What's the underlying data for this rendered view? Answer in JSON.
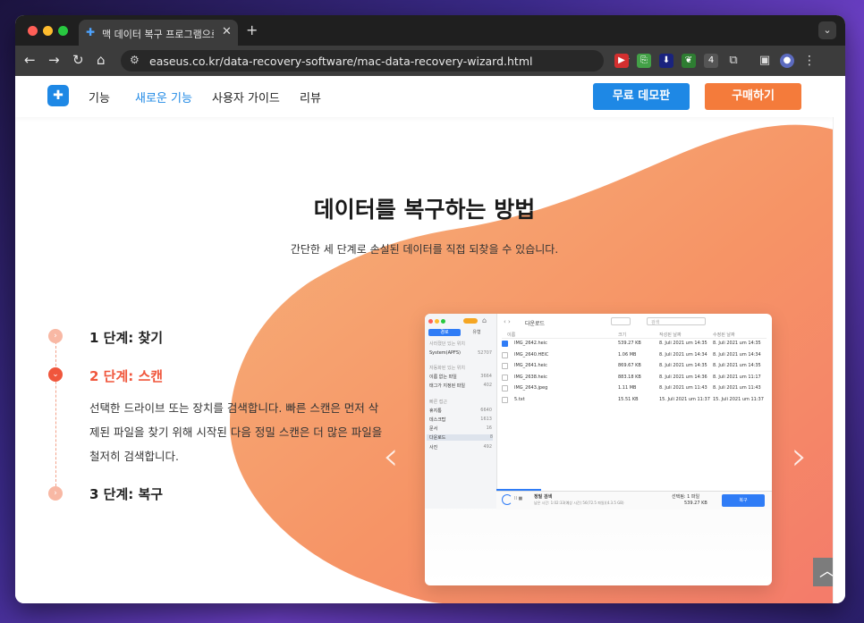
{
  "browser": {
    "tab_title": "맥 데이터 복구 프로그램으로 손실된",
    "url": "easeus.co.kr/data-recovery-software/mac-data-recovery-wizard.html",
    "ext_badge": "4"
  },
  "header": {
    "menu": [
      "기능",
      "새로운 기능",
      "사용자 가이드",
      "리뷰"
    ],
    "demo_button": "무료 데모판",
    "buy_button": "구매하기"
  },
  "hero": {
    "title": "데이터를 복구하는 방법",
    "subtitle": "간단한 세 단계로 손실된 데이터를 직접 되찾을 수 있습니다."
  },
  "steps": [
    {
      "label": "1 단계: 찾기"
    },
    {
      "label": "2 단계: 스캔",
      "description": "선택한 드라이브 또는 장치를 검색합니다. 빠른 스캔은 먼저 삭제된 파일을 찾기 위해 시작된 다음 정밀 스캔은 더 많은 파일을 철저히 검색합니다."
    },
    {
      "label": "3 단계: 복구"
    }
  ],
  "screenshot": {
    "folder_title": "다운로드",
    "search_placeholder": "검색",
    "sidebar_tabs": [
      "경로",
      "유형"
    ],
    "sidebar_section1": "사라졌던 있는 위치",
    "sidebar_items1": [
      {
        "name": "System(APFS)",
        "count": "52707"
      }
    ],
    "sidebar_section2": "자동화된 있는 위치",
    "sidebar_items2": [
      {
        "name": "이름 없는 파일",
        "count": "3664"
      },
      {
        "name": "태그가 지정된 파일",
        "count": "402"
      }
    ],
    "sidebar_section3": "빠른 접근",
    "sidebar_items3": [
      {
        "name": "휴지통",
        "count": "6640"
      },
      {
        "name": "데스크탑",
        "count": "1613"
      },
      {
        "name": "문서",
        "count": "16"
      },
      {
        "name": "다운로드",
        "count": "8"
      },
      {
        "name": "사진",
        "count": "492"
      }
    ],
    "columns": [
      "이름",
      "크기",
      "작성된 날짜",
      "수정된 날짜"
    ],
    "files": [
      {
        "name": "IMG_2642.heic",
        "size": "539.27 KB",
        "created": "8. Juli 2021 um 14:35",
        "modified": "8. Juli 2021 um 14:35",
        "checked": true
      },
      {
        "name": "IMG_2640.HEIC",
        "size": "1.06 MB",
        "created": "8. Juli 2021 um 14:34",
        "modified": "8. Juli 2021 um 14:34",
        "checked": false
      },
      {
        "name": "IMG_2641.heic",
        "size": "869.67 KB",
        "created": "8. Juli 2021 um 14:35",
        "modified": "8. Juli 2021 um 14:35",
        "checked": false
      },
      {
        "name": "IMG_2638.heic",
        "size": "883.18 KB",
        "created": "8. Juli 2021 um 14:36",
        "modified": "8. Juli 2021 um 11:17",
        "checked": false
      },
      {
        "name": "IMG_2643.jpeg",
        "size": "1.11 MB",
        "created": "8. Juli 2021 um 11:43",
        "modified": "8. Juli 2021 um 11:43",
        "checked": false
      },
      {
        "name": "5.txt",
        "size": "15.51 KB",
        "created": "15. Juli 2021 um 11:37",
        "modified": "15. Juli 2021 um 11:37",
        "checked": false
      }
    ],
    "scan_title": "정밀 검색",
    "scan_status": "남은 시간: 1:02:33(예상 시간) 56(72.5 파일)(4.3.5 GB)",
    "selected_info": "선택됨: 1 파일",
    "selected_size": "539.27 KB",
    "recover_button": "복구"
  },
  "colors": {
    "accent_orange": "#f47b4b",
    "accent_blue": "#1e88e5"
  }
}
